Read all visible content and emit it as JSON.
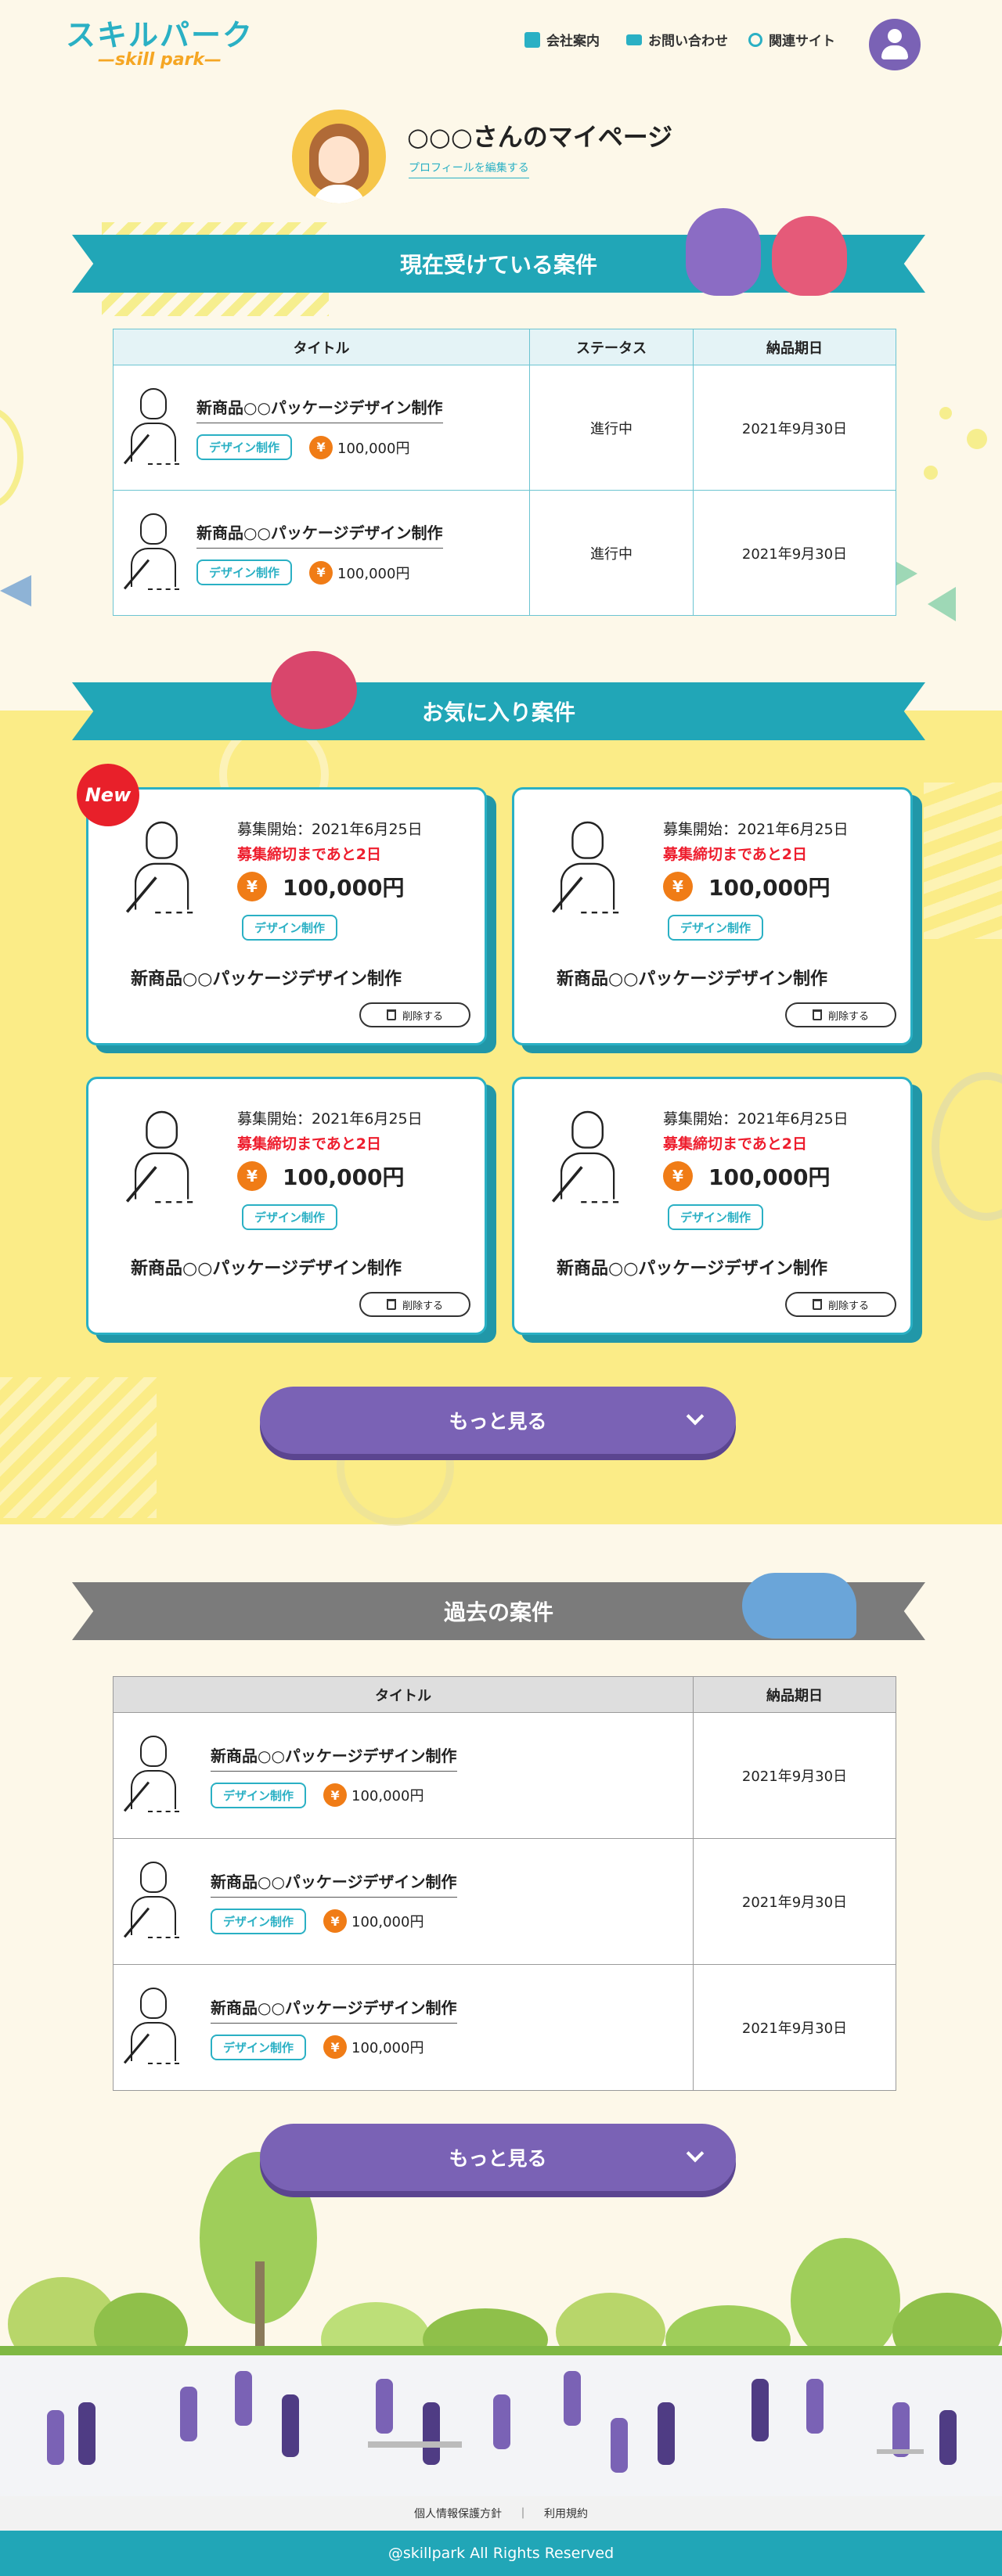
{
  "header": {
    "logo_main": "スキルパーク",
    "logo_sub": "—skill park—",
    "nav": [
      {
        "label": "会社案内",
        "icon": "building-icon"
      },
      {
        "label": "お問い合わせ",
        "icon": "mail-icon"
      },
      {
        "label": "関連サイト",
        "icon": "link-icon"
      }
    ],
    "account_icon": "user-icon"
  },
  "profile": {
    "title": "○○○さんのマイページ",
    "edit_link": "プロフィールを編集する"
  },
  "current": {
    "heading": "現在受けている案件",
    "columns": [
      "タイトル",
      "ステータス",
      "納品期日"
    ],
    "rows": [
      {
        "title": "新商品○○パッケージデザイン制作",
        "tag": "デザイン制作",
        "price": "100,000円",
        "status": "進行中",
        "due": "2021年9月30日"
      },
      {
        "title": "新商品○○パッケージデザイン制作",
        "tag": "デザイン制作",
        "price": "100,000円",
        "status": "進行中",
        "due": "2021年9月30日"
      }
    ]
  },
  "favorites": {
    "heading": "お気に入り案件",
    "new_badge": "New",
    "cards": [
      {
        "start": "募集開始：2021年6月25日",
        "deadline": "募集締切まであと2日",
        "price": "100,000円",
        "tag": "デザイン制作",
        "title": "新商品○○パッケージデザイン制作",
        "delete": "削除する"
      },
      {
        "start": "募集開始：2021年6月25日",
        "deadline": "募集締切まであと2日",
        "price": "100,000円",
        "tag": "デザイン制作",
        "title": "新商品○○パッケージデザイン制作",
        "delete": "削除する"
      },
      {
        "start": "募集開始：2021年6月25日",
        "deadline": "募集締切まであと2日",
        "price": "100,000円",
        "tag": "デザイン制作",
        "title": "新商品○○パッケージデザイン制作",
        "delete": "削除する"
      },
      {
        "start": "募集開始：2021年6月25日",
        "deadline": "募集締切まであと2日",
        "price": "100,000円",
        "tag": "デザイン制作",
        "title": "新商品○○パッケージデザイン制作",
        "delete": "削除する"
      }
    ],
    "more": "もっと見る"
  },
  "past": {
    "heading": "過去の案件",
    "columns": [
      "タイトル",
      "納品期日"
    ],
    "rows": [
      {
        "title": "新商品○○パッケージデザイン制作",
        "tag": "デザイン制作",
        "price": "100,000円",
        "due": "2021年9月30日"
      },
      {
        "title": "新商品○○パッケージデザイン制作",
        "tag": "デザイン制作",
        "price": "100,000円",
        "due": "2021年9月30日"
      },
      {
        "title": "新商品○○パッケージデザイン制作",
        "tag": "デザイン制作",
        "price": "100,000円",
        "due": "2021年9月30日"
      }
    ],
    "more": "もっと見る"
  },
  "footer": {
    "privacy": "個人情報保護方針",
    "separator": "｜",
    "terms": "利用規約",
    "copyright": "@skillpark All Rights Reserved"
  },
  "colors": {
    "teal": "#21a6b7",
    "purple": "#7a62b5",
    "yellow": "#fbec87",
    "cream": "#fdf8e9",
    "orange": "#f07c16",
    "red": "#ee1d2d"
  },
  "yen_symbol": "¥"
}
